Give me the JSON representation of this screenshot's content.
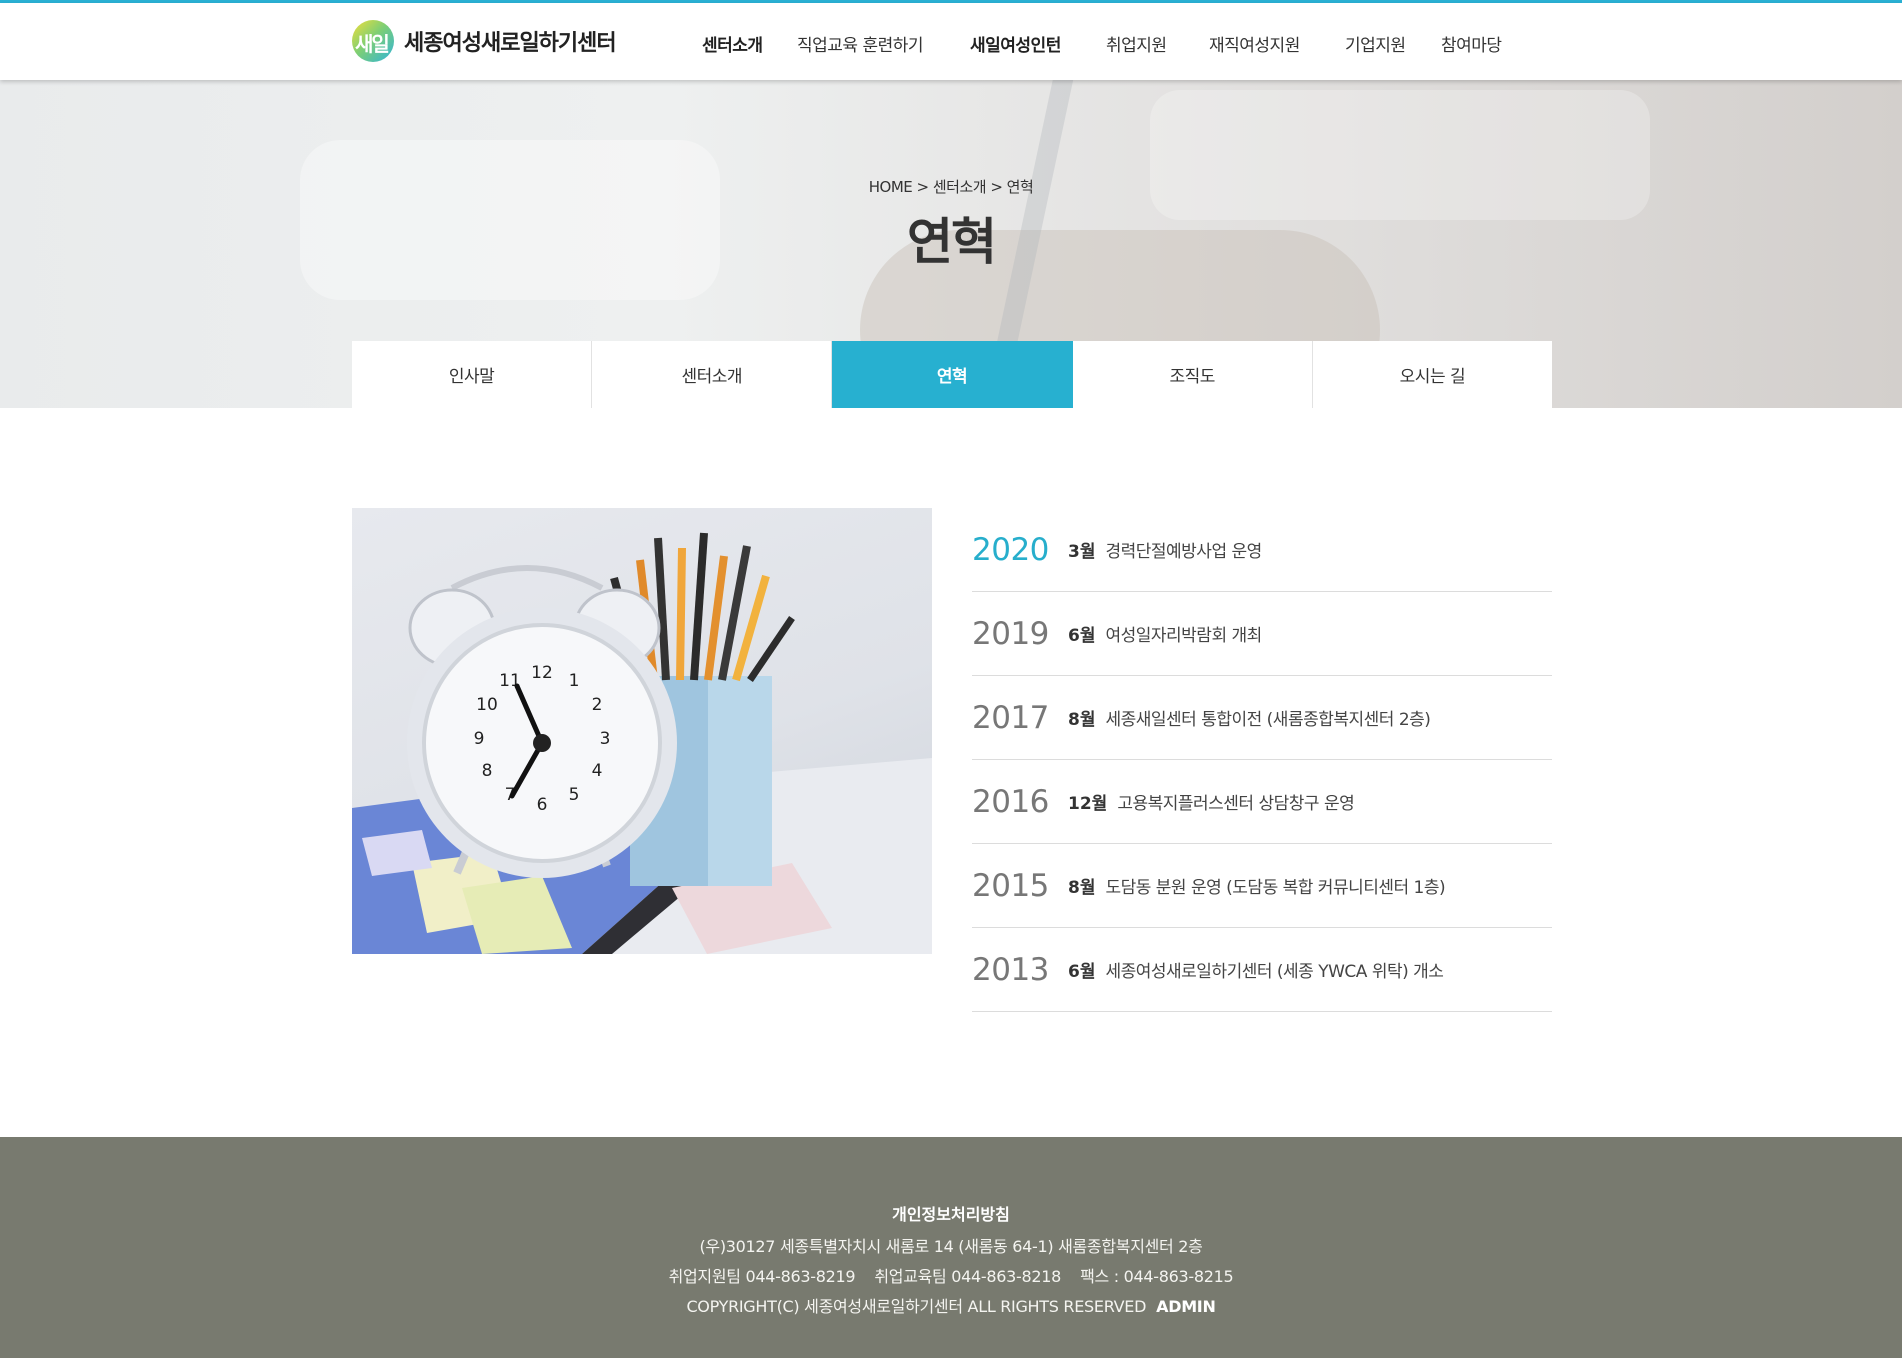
{
  "header": {
    "logo_badge": "새일",
    "logo_text": "세종여성새로일하기센터",
    "nav": [
      "센터소개",
      "직업교육 훈련하기",
      "새일여성인턴",
      "취업지원",
      "재직여성지원",
      "기업지원",
      "참여마당"
    ]
  },
  "visual": {
    "breadcrumb": "HOME > 센터소개 > 연혁",
    "title": "연혁"
  },
  "tabs": [
    "인사말",
    "센터소개",
    "연혁",
    "조직도",
    "오시는 길"
  ],
  "active_tab": "연혁",
  "history": [
    {
      "year": "2020",
      "month": "3월",
      "desc": "경력단절예방사업 운영"
    },
    {
      "year": "2019",
      "month": "6월",
      "desc": "여성일자리박람회 개최"
    },
    {
      "year": "2017",
      "month": "8월",
      "desc": "세종새일센터 통합이전 (새롬종합복지센터 2층)"
    },
    {
      "year": "2016",
      "month": "12월",
      "desc": "고용복지플러스센터 상담창구 운영"
    },
    {
      "year": "2015",
      "month": "8월",
      "desc": "도담동 분원 운영 (도담동 복합 커뮤니티센터 1층)"
    },
    {
      "year": "2013",
      "month": "6월",
      "desc": "세종여성새로일하기센터 (세종 YWCA 위탁) 개소"
    }
  ],
  "footer": {
    "privacy": "개인정보처리방침",
    "address": "(우)30127 세종특별자치시 새롬로 14 (새롬동 64-1) 새롬종합복지센터 2층",
    "contacts": "취업지원팀 044-863-8219    취업교육팀 044-863-8218    팩스 : 044-863-8215",
    "copyright": "COPYRIGHT(C) 세종여성새로일하기센터 ALL RIGHTS RESERVED",
    "admin": "ADMIN"
  },
  "colors": {
    "accent": "#27b0d0",
    "footer_bg": "#787a6f"
  },
  "photo": {
    "clock_numbers": [
      "12",
      "1",
      "2",
      "3",
      "4",
      "5",
      "6",
      "7",
      "8",
      "9",
      "10",
      "11"
    ]
  }
}
